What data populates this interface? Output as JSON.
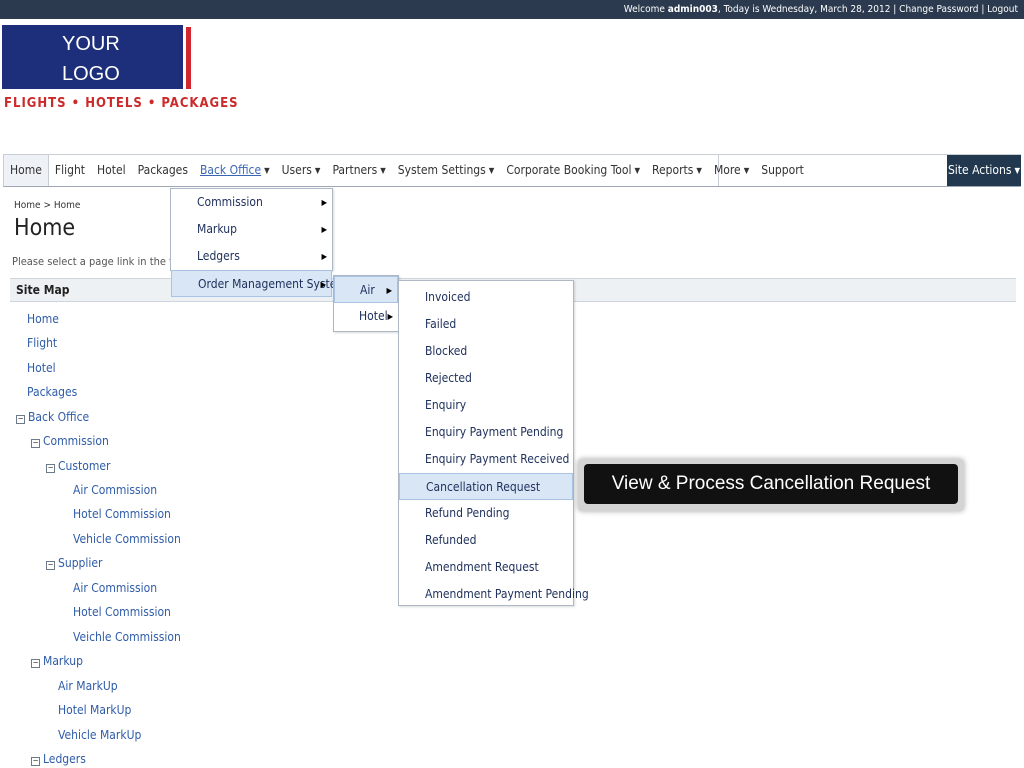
{
  "topbar": {
    "welcome_prefix": "Welcome",
    "username": "admin003",
    "date_text": ", Today is Wednesday, March 28, 2012 |",
    "change_password": "Change Password",
    "separator": "|",
    "logout": "Logout"
  },
  "logo": {
    "line1": "YOUR",
    "line2": "LOGO",
    "tagline": "FLIGHTS • HOTELS • PACKAGES"
  },
  "nav": {
    "items": [
      {
        "label": "Home"
      },
      {
        "label": "Flight"
      },
      {
        "label": "Hotel"
      },
      {
        "label": "Packages"
      },
      {
        "label": "Back Office"
      },
      {
        "label": "Users"
      },
      {
        "label": "Partners"
      },
      {
        "label": "System Settings"
      },
      {
        "label": "Corporate Booking Tool"
      },
      {
        "label": "Reports"
      },
      {
        "label": "More"
      },
      {
        "label": "Support"
      }
    ],
    "site_actions": "Site Actions"
  },
  "page": {
    "breadcrumb_root": "Home",
    "breadcrumb_sep": ">",
    "breadcrumb_current": "Home",
    "title": "Home",
    "description": "Please select a page link in the table",
    "sitemap_label": "Site Map"
  },
  "tree": [
    {
      "label": "Home"
    },
    {
      "label": "Flight"
    },
    {
      "label": "Hotel"
    },
    {
      "label": "Packages"
    },
    {
      "label": "Back Office"
    },
    {
      "label": "Commission"
    },
    {
      "label": "Customer"
    },
    {
      "label": "Air Commission"
    },
    {
      "label": "Hotel Commission"
    },
    {
      "label": "Vehicle Commission"
    },
    {
      "label": "Supplier"
    },
    {
      "label": "Air Commission"
    },
    {
      "label": "Hotel Commission"
    },
    {
      "label": "Veichle Commission"
    },
    {
      "label": "Markup"
    },
    {
      "label": "Air MarkUp"
    },
    {
      "label": "Hotel MarkUp"
    },
    {
      "label": "Vehicle MarkUp"
    },
    {
      "label": "Ledgers"
    }
  ],
  "back_office_menu": [
    "Commission",
    "Markup",
    "Ledgers",
    "Order Management System"
  ],
  "oms_menu": [
    "Air",
    "Hotel"
  ],
  "air_menu": [
    "Invoiced",
    "Failed",
    "Blocked",
    "Rejected",
    "Enquiry",
    "Enquiry Payment Pending",
    "Enquiry Payment Received",
    "Cancellation Request",
    "Refund Pending",
    "Refunded",
    "Amendment Request",
    "Amendment Payment Pending"
  ],
  "callout": "View & Process Cancellation Request"
}
